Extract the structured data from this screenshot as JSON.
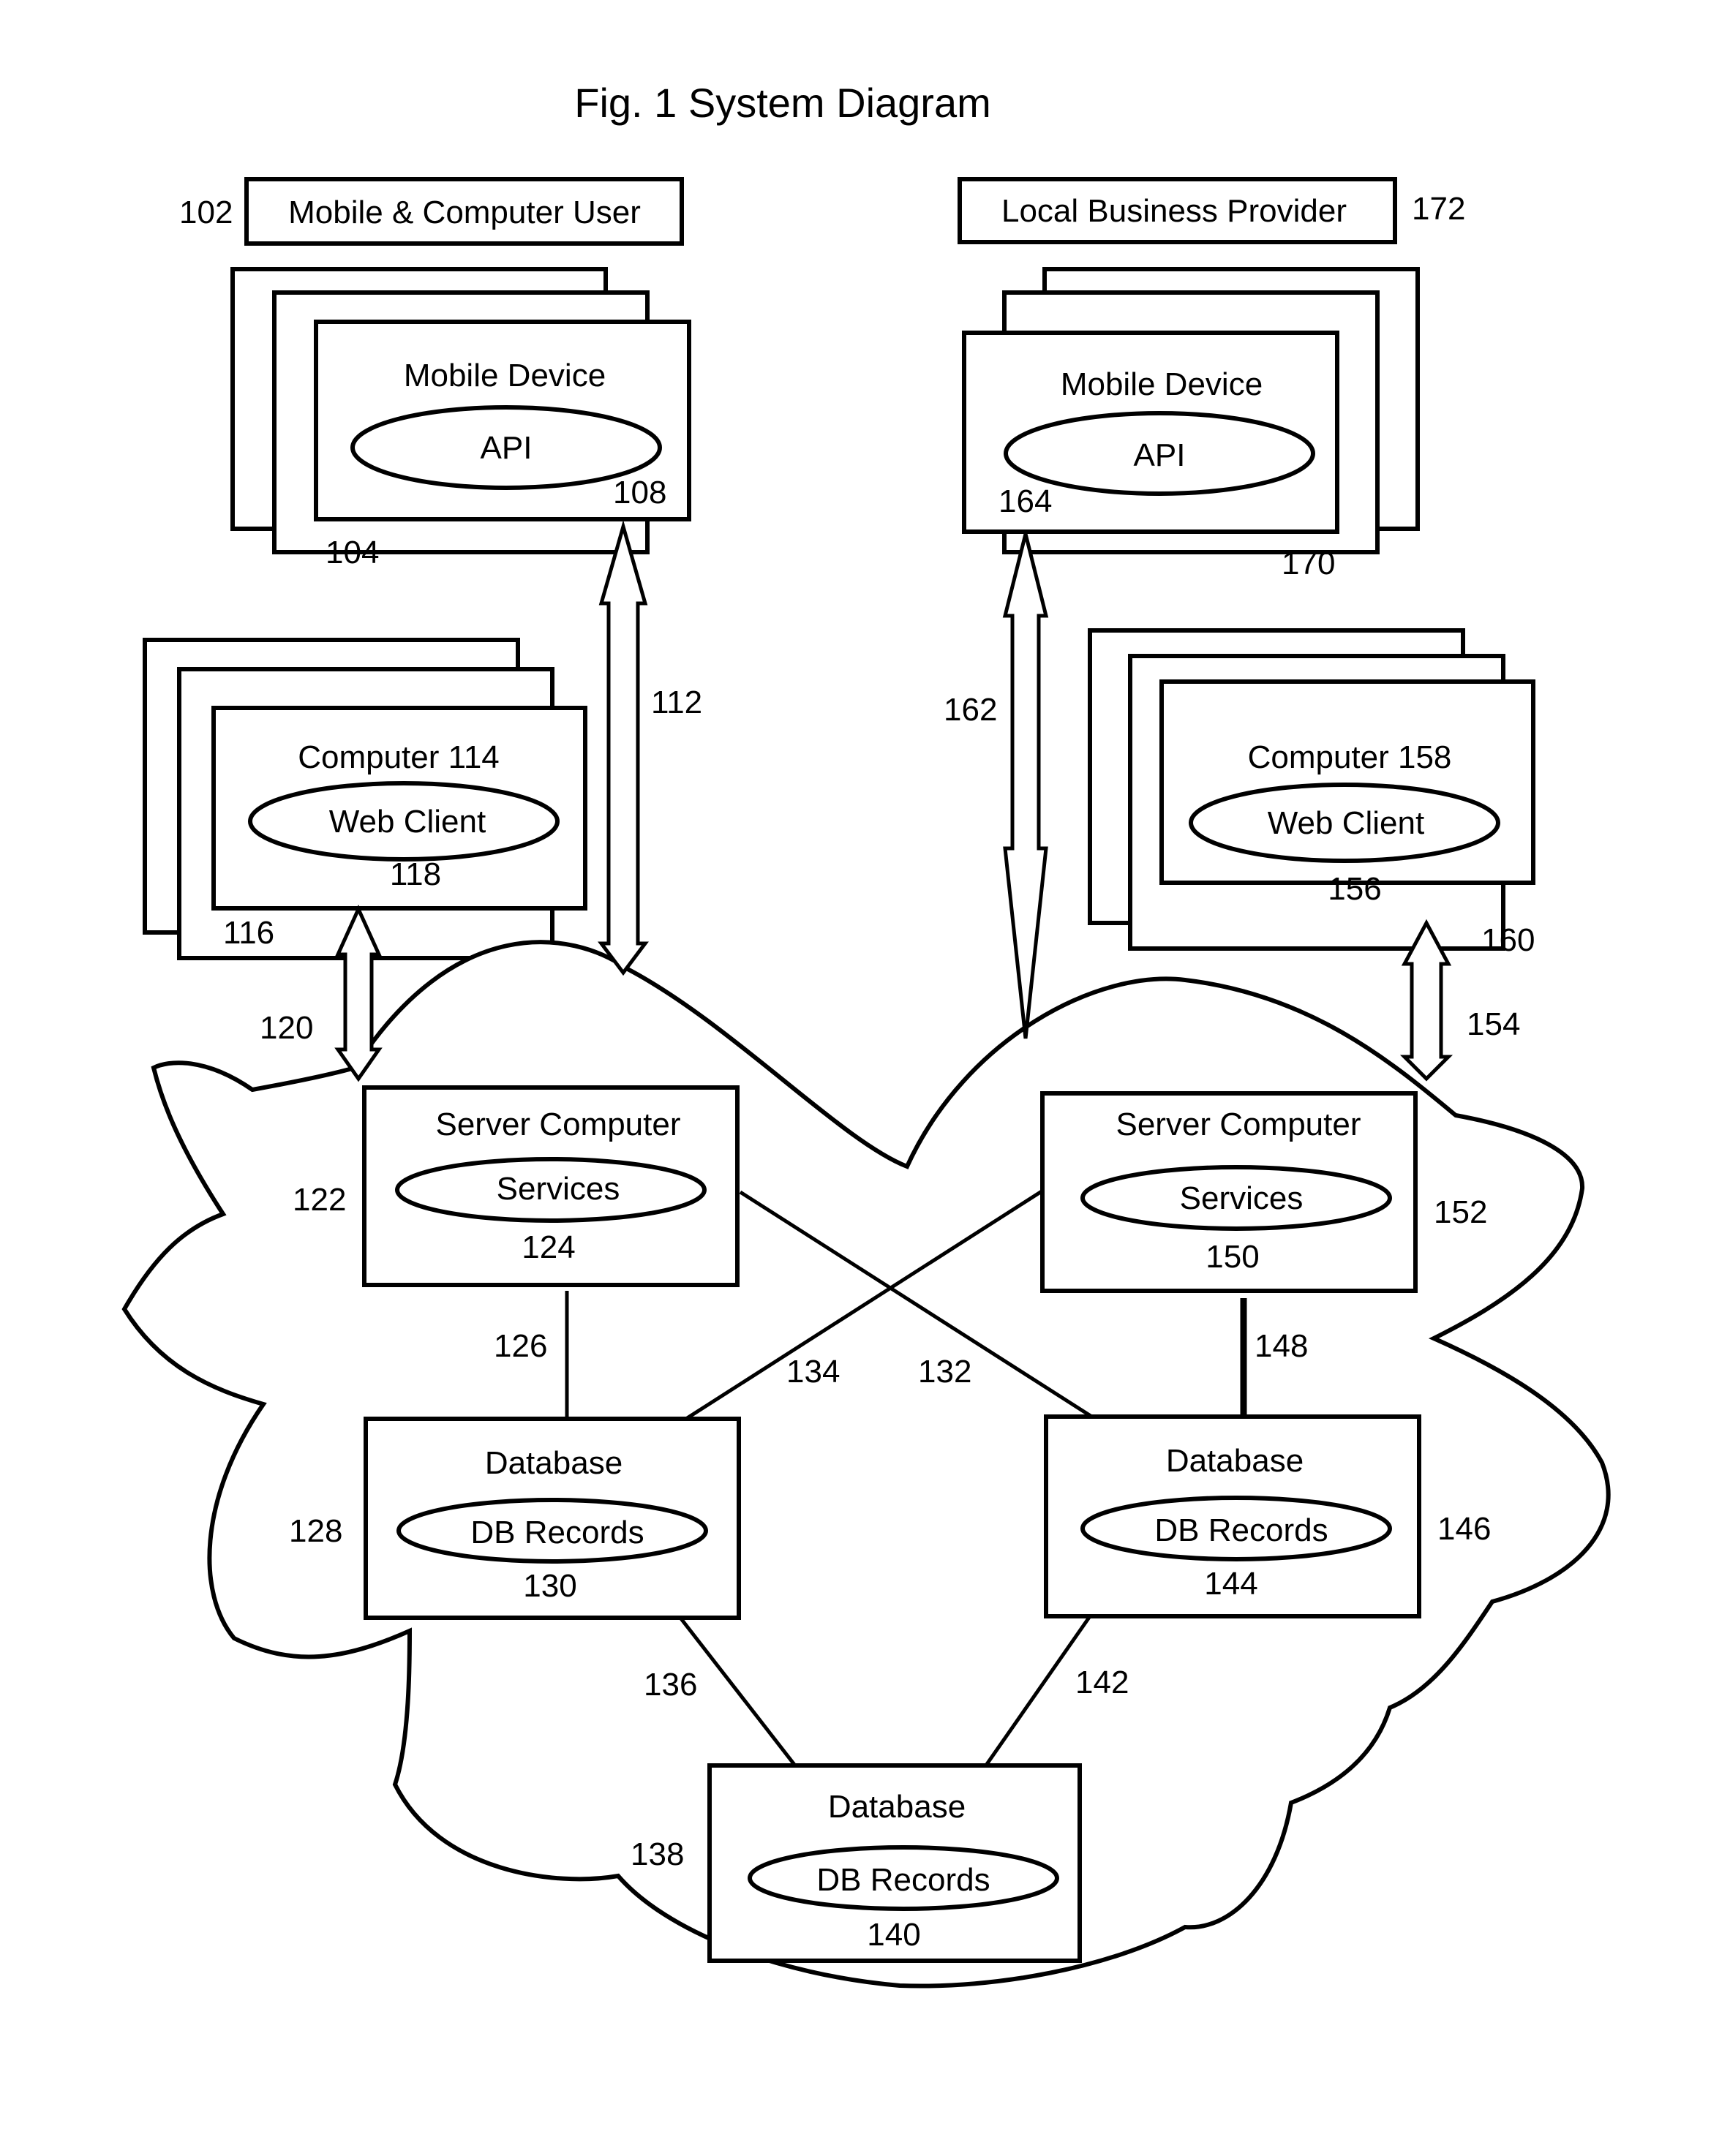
{
  "title": "Fig. 1  System Diagram",
  "actors": {
    "user": {
      "label": "Mobile & Computer User",
      "ref": "102"
    },
    "provider": {
      "label": "Local Business Provider",
      "ref": "172"
    }
  },
  "devices": {
    "user_mobile": {
      "title": "Mobile Device",
      "component": "API",
      "component_ref": "108",
      "stack_ref": "104"
    },
    "provider_mobile": {
      "title": "Mobile Device",
      "component": "API",
      "component_ref": "164",
      "stack_ref": "170"
    },
    "user_computer": {
      "title": "Computer 114",
      "component": "Web Client",
      "component_ref": "118",
      "stack_ref": "116"
    },
    "provider_computer": {
      "title": "Computer 158",
      "component": "Web Client",
      "component_ref": "156",
      "stack_ref": "160"
    }
  },
  "servers": {
    "left": {
      "title": "Server Computer",
      "component": "Services",
      "component_ref": "124",
      "box_ref": "122"
    },
    "right": {
      "title": "Server Computer",
      "component": "Services",
      "component_ref": "150",
      "box_ref": "152"
    }
  },
  "databases": {
    "left": {
      "title": "Database",
      "component": "DB Records",
      "component_ref": "130",
      "box_ref": "128"
    },
    "right": {
      "title": "Database",
      "component": "DB Records",
      "component_ref": "144",
      "box_ref": "146"
    },
    "bottom": {
      "title": "Database",
      "component": "DB Records",
      "component_ref": "140",
      "box_ref": "138"
    }
  },
  "connections": {
    "user_mobile_link": "112",
    "user_computer_link": "120",
    "provider_mobile_link": "162",
    "provider_computer_link": "154",
    "left_server_left_db": "126",
    "left_server_right_db": "132",
    "right_server_left_db": "134",
    "right_server_right_db": "148",
    "left_db_bottom_db": "136",
    "right_db_bottom_db": "142"
  }
}
